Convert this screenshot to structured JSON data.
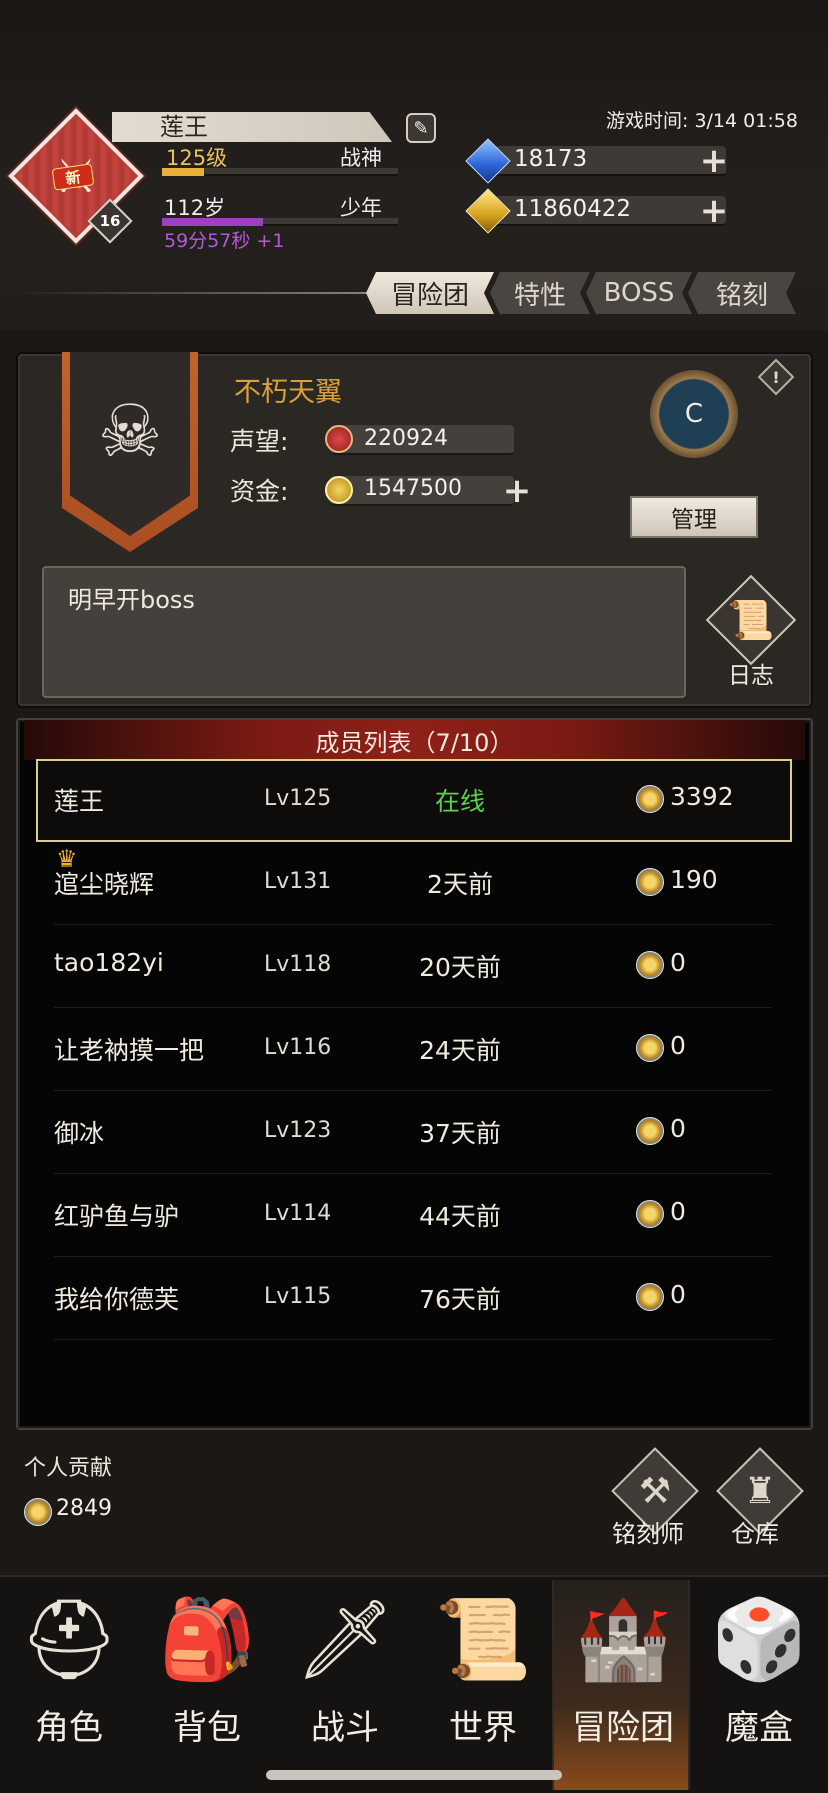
{
  "player": {
    "name": "莲王",
    "avatar_badge": "新",
    "avatar_level": "16",
    "level": "125级",
    "class": "战神",
    "xp_fraction": 0.18,
    "age": "112岁",
    "age_stage": "少年",
    "age_fraction": 0.43,
    "age_timer": "59分57秒 +1"
  },
  "game_time": "游戏时间: 3/14 01:58",
  "resources": {
    "gems": "18173",
    "gold": "11860422"
  },
  "tabs": [
    {
      "label": "冒险团",
      "active": true
    },
    {
      "label": "特性",
      "active": false
    },
    {
      "label": "BOSS",
      "active": false
    },
    {
      "label": "铭刻",
      "active": false
    }
  ],
  "guild": {
    "name": "不朽天翼",
    "prestige_label": "声望:",
    "prestige": "220924",
    "funds_label": "资金:",
    "funds": "1547500",
    "rank": "C",
    "manage_label": "管理",
    "notice": "明早开boss",
    "log_label": "日志"
  },
  "members": {
    "title": "成员列表（7/10）",
    "rows": [
      {
        "name": "莲王",
        "level": "Lv125",
        "status": "在线",
        "contribution": "3392",
        "is_self": true,
        "leader": false
      },
      {
        "name": "逭尘晓辉",
        "level": "Lv131",
        "status": "2天前",
        "contribution": "190",
        "is_self": false,
        "leader": true
      },
      {
        "name": "tao182yi",
        "level": "Lv118",
        "status": "20天前",
        "contribution": "0",
        "is_self": false,
        "leader": false
      },
      {
        "name": "让老衲摸一把",
        "level": "Lv116",
        "status": "24天前",
        "contribution": "0",
        "is_self": false,
        "leader": false
      },
      {
        "name": "御冰",
        "level": "Lv123",
        "status": "37天前",
        "contribution": "0",
        "is_self": false,
        "leader": false
      },
      {
        "name": "红驴鱼与驴",
        "level": "Lv114",
        "status": "44天前",
        "contribution": "0",
        "is_self": false,
        "leader": false
      },
      {
        "name": "我给你德芙",
        "level": "Lv115",
        "status": "76天前",
        "contribution": "0",
        "is_self": false,
        "leader": false
      }
    ]
  },
  "personal": {
    "label": "个人贡献",
    "value": "2849"
  },
  "actions": {
    "engraver": "铭刻师",
    "warehouse": "仓库"
  },
  "nav": [
    {
      "label": "角色",
      "icon": "helmet-icon",
      "active": false
    },
    {
      "label": "背包",
      "icon": "backpack-icon",
      "active": false
    },
    {
      "label": "战斗",
      "icon": "sword-shield-icon",
      "active": false
    },
    {
      "label": "世界",
      "icon": "scroll-map-icon",
      "active": false
    },
    {
      "label": "冒险团",
      "icon": "castle-icon",
      "active": true
    },
    {
      "label": "魔盒",
      "icon": "magic-box-icon",
      "active": false
    }
  ]
}
